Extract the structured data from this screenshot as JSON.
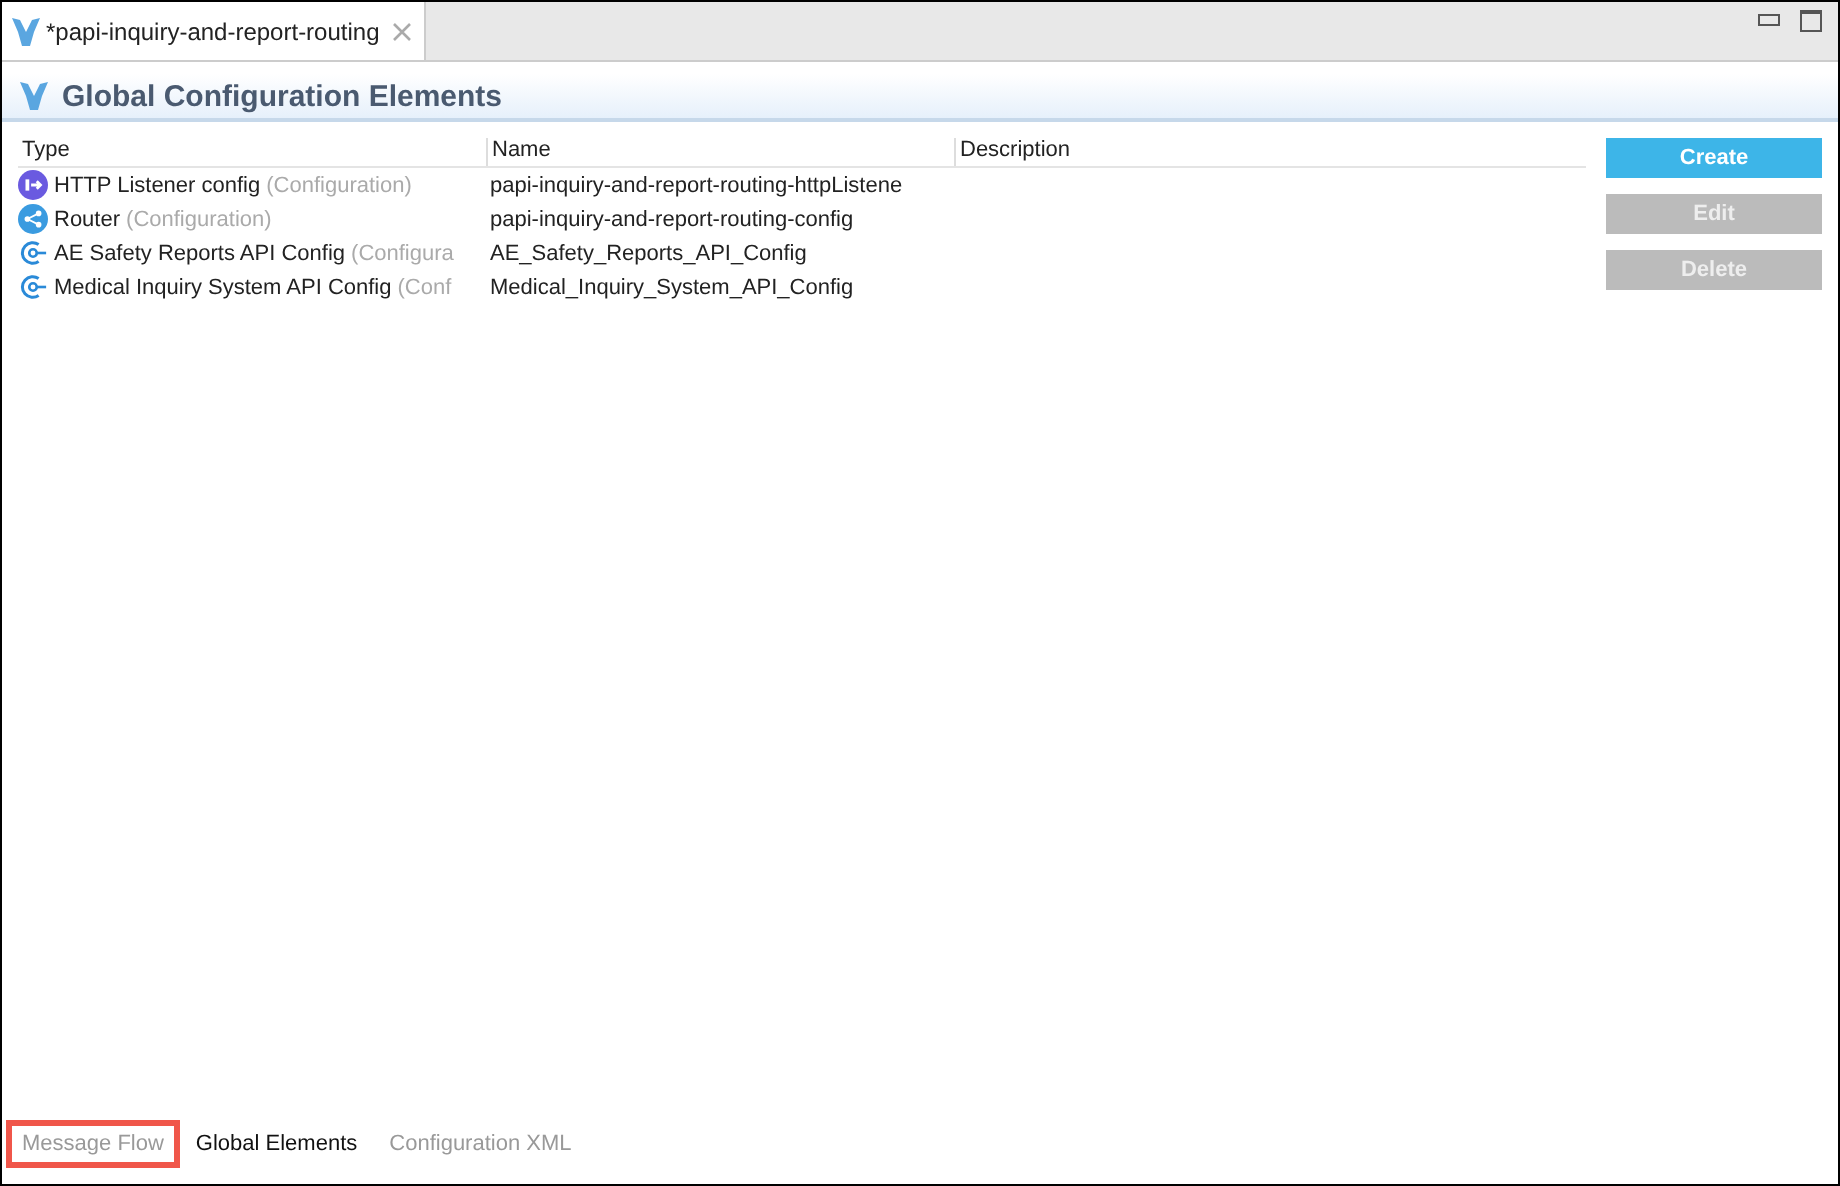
{
  "editor_tab": {
    "title": "*papi-inquiry-and-report-routing",
    "selected": true
  },
  "header": {
    "title": "Global Configuration Elements"
  },
  "table": {
    "columns": [
      "Type",
      "Name",
      "Description"
    ],
    "rows": [
      {
        "kind": "listener",
        "type": "HTTP Listener config",
        "type_hint": "(Configuration)",
        "name": "papi-inquiry-and-report-routing-httpListene"
      },
      {
        "kind": "router",
        "type": "Router",
        "type_hint": "(Configuration)",
        "name": "papi-inquiry-and-report-routing-config"
      },
      {
        "kind": "api",
        "type": "AE Safety Reports API Config",
        "type_hint": "(Configura",
        "name": "AE_Safety_Reports_API_Config"
      },
      {
        "kind": "api",
        "type": "Medical Inquiry System API Config",
        "type_hint": "(Conf",
        "name": "Medical_Inquiry_System_API_Config"
      }
    ]
  },
  "buttons": [
    {
      "label": "Create",
      "disabled": false
    },
    {
      "label": "Edit",
      "disabled": true
    },
    {
      "label": "Delete",
      "disabled": true
    }
  ],
  "bottom_tabs": [
    {
      "label": "Message Flow",
      "selected": false,
      "highlighted": true
    },
    {
      "label": "Global Elements",
      "selected": true,
      "highlighted": false
    },
    {
      "label": "Configuration XML",
      "selected": false,
      "highlighted": false
    }
  ]
}
